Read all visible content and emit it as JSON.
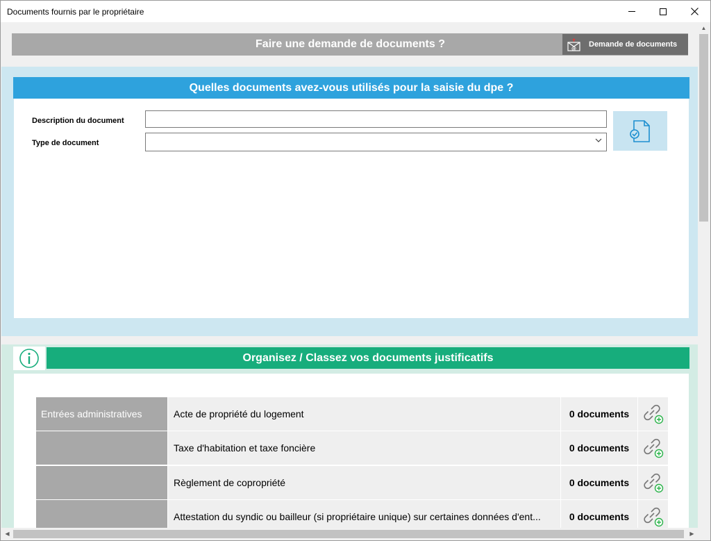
{
  "window": {
    "title": "Documents fournis par le propriétaire"
  },
  "request": {
    "title": "Faire une demande de documents ?",
    "button_label": "Demande de documents"
  },
  "used_docs": {
    "header": "Quelles documents avez-vous utilisés pour la saisie du dpe ?",
    "description_label": "Description du document",
    "description_value": "",
    "type_label": "Type de document",
    "type_value": ""
  },
  "organize": {
    "header": "Organisez / Classez vos documents justificatifs",
    "rows": [
      {
        "category": "Entrées administratives",
        "description": "Acte de propriété du logement",
        "count": "0 documents"
      },
      {
        "category": "",
        "description": "Taxe d'habitation et taxe foncière",
        "count": "0 documents"
      },
      {
        "category": "",
        "description": "Règlement de copropriété",
        "count": "0 documents"
      },
      {
        "category": "",
        "description": "Attestation du syndic ou bailleur (si propriétaire unique) sur certaines données d'ent...",
        "count": "0 documents"
      }
    ]
  },
  "colors": {
    "blue_header": "#2ea2dd",
    "green_header": "#17ad7c",
    "grey_bar": "#a8a8a8",
    "button_dark": "#6e6e6e"
  },
  "icons": {
    "request_button": "mail-at-icon",
    "add_document": "document-check-icon",
    "info": "info-circle-icon",
    "link": "link-add-icon"
  }
}
